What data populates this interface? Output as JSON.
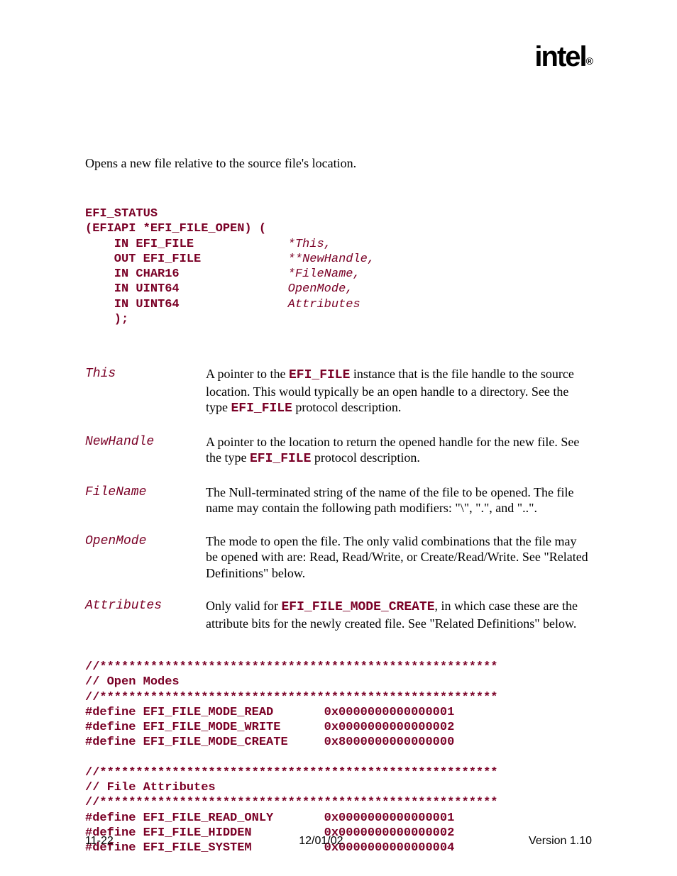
{
  "logo": "intel",
  "summary": "Opens a new file relative to the source file's location.",
  "prototype": {
    "l1": "EFI_STATUS",
    "l2": "(EFIAPI *EFI_FILE_OPEN) (",
    "l3a": "    IN EFI_FILE",
    "l3b": "             *",
    "l3c": "This,",
    "l4a": "    OUT EFI_FILE",
    "l4b": "            **",
    "l4c": "NewHandle,",
    "l5a": "    IN CHAR16",
    "l5b": "               *",
    "l5c": "FileName,",
    "l6a": "    IN UINT64",
    "l6b": "               ",
    "l6c": "OpenMode,",
    "l7a": "    IN UINT64",
    "l7b": "               ",
    "l7c": "Attributes",
    "l8": "    );"
  },
  "params": {
    "p1": {
      "name": "This",
      "d1": "A pointer to the ",
      "d2": "EFI_FILE",
      "d3": " instance that is the file handle to the source location.  This would typically be an open handle to a directory.  See the type ",
      "d4": "EFI_FILE",
      "d5": " protocol description."
    },
    "p2": {
      "name": "NewHandle",
      "d1": "A pointer to the location to return the opened handle for the new file.  See the type ",
      "d2": "EFI_FILE",
      "d3": " protocol description."
    },
    "p3": {
      "name": "FileName",
      "d1": "The Null-terminated string of the name of the file to be opened.  The file name may contain the following path modifiers: \"\\\", \".\", and \"..\"."
    },
    "p4": {
      "name": "OpenMode",
      "d1": "The mode to open the file.  The only valid combinations that the file may be opened with are: Read, Read/Write, or Create/Read/Write.  See \"Related Definitions\" below."
    },
    "p5": {
      "name": "Attributes",
      "d1": "Only valid for ",
      "d2": "EFI_FILE_MODE_CREATE",
      "d3": ", in which case these are the attribute bits for the newly created file.  See \"Related Definitions\" below."
    }
  },
  "defs": {
    "l1": "//*******************************************************",
    "l2": "// Open Modes",
    "l3": "//*******************************************************",
    "l4": "#define EFI_FILE_MODE_READ       0x0000000000000001",
    "l5": "#define EFI_FILE_MODE_WRITE      0x0000000000000002",
    "l6": "#define EFI_FILE_MODE_CREATE     0x8000000000000000",
    "l7": "",
    "l8": "//*******************************************************",
    "l9": "// File Attributes",
    "l10": "//*******************************************************",
    "l11": "#define EFI_FILE_READ_ONLY       0x0000000000000001",
    "l12": "#define EFI_FILE_HIDDEN          0x0000000000000002",
    "l13": "#define EFI_FILE_SYSTEM          0x0000000000000004"
  },
  "footer": {
    "left": "11-22",
    "center": "12/01/02",
    "right": "Version 1.10"
  }
}
